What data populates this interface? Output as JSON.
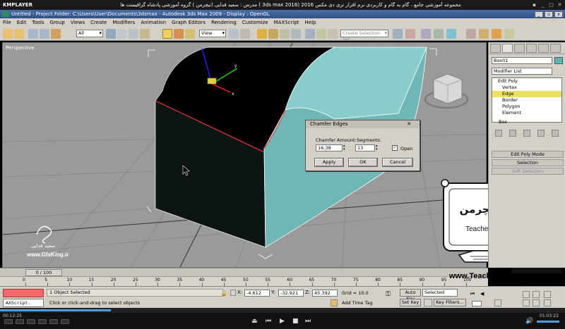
{
  "player": {
    "name": "KMPLAYER",
    "title": "مجموعه آموزشی جامع ، گام به گام و کاربردی نرم افزار تری دی مکس 2016 (3ds max 2016 ) مدرس : سعید فدایی (تیچرمن ) گروه آموزشی پادشاه گرافیست ها",
    "time_elapsed": "00:12:25",
    "time_total": "01:03:22",
    "progress": 0.196
  },
  "max": {
    "title": "Untitled    -    Project Folder: C:\\Users\\User\\Documents\\3dsmax    -    Autodesk 3ds Max  2009    -    Display : OpenGL",
    "menu": [
      "File",
      "Edit",
      "Tools",
      "Group",
      "Views",
      "Create",
      "Modifiers",
      "Animation",
      "Graph Editors",
      "Rendering",
      "Customize",
      "MAXScript",
      "Help"
    ],
    "toolbar": {
      "filter_value": "All",
      "ref_coord_value": "View",
      "named_sel_placeholder": "Create Selection Set"
    },
    "viewport": {
      "label": "Perspective"
    },
    "command_panel": {
      "object_name": "Box01",
      "modifier_list": "Modifier List",
      "stack": [
        {
          "label": "Edit Poly",
          "root": true
        },
        {
          "label": "Vertex"
        },
        {
          "label": "Edge",
          "selected": true
        },
        {
          "label": "Border"
        },
        {
          "label": "Polygon"
        },
        {
          "label": "Element"
        }
      ],
      "base_object": "Box",
      "rollouts": [
        {
          "label": "Edit Poly Mode",
          "dim": false
        },
        {
          "label": "Selection",
          "dim": false
        },
        {
          "label": "Soft Selection",
          "dim": true
        }
      ],
      "swatch_color": "#55b8b8"
    },
    "dialog": {
      "title": "Chamfer Edges",
      "amount_label": "Chamfer Amount:",
      "amount_value": "16.38",
      "segments_label": "Segments:",
      "segments_value": "13",
      "open_label": "Open",
      "open_checked": true,
      "apply": "Apply",
      "ok": "OK",
      "cancel": "Cancel"
    },
    "timeline": {
      "slider": "0 / 100",
      "ticks": [
        "0",
        "5",
        "10",
        "15",
        "20",
        "25",
        "30",
        "35",
        "40",
        "45",
        "50",
        "55",
        "60",
        "65",
        "70",
        "75",
        "80",
        "85",
        "90",
        "95",
        "100"
      ]
    },
    "status": {
      "maxscript": "AXScript.",
      "selected": "1 Object Selected",
      "prompt": "Click or click-and-drag to select objects",
      "x_label": "X:",
      "x": "-4.612",
      "y_label": "Y:",
      "y": "-32.921",
      "z_label": "Z:",
      "z": "45.392",
      "grid": "Grid = 10.0",
      "add_time_tag": "Add Time Tag",
      "auto_key": "Auto Key",
      "selected_dropdown": "Selected",
      "set_key": "Set Key",
      "key_filters": "Key Filters..."
    }
  },
  "watermark": {
    "url": "www.TeacherMan.ir",
    "site": "www.GfxKing.ir",
    "author": "سعید فدایی",
    "brand": "Teacher Man",
    "brand_fa": "تیچرمن"
  }
}
